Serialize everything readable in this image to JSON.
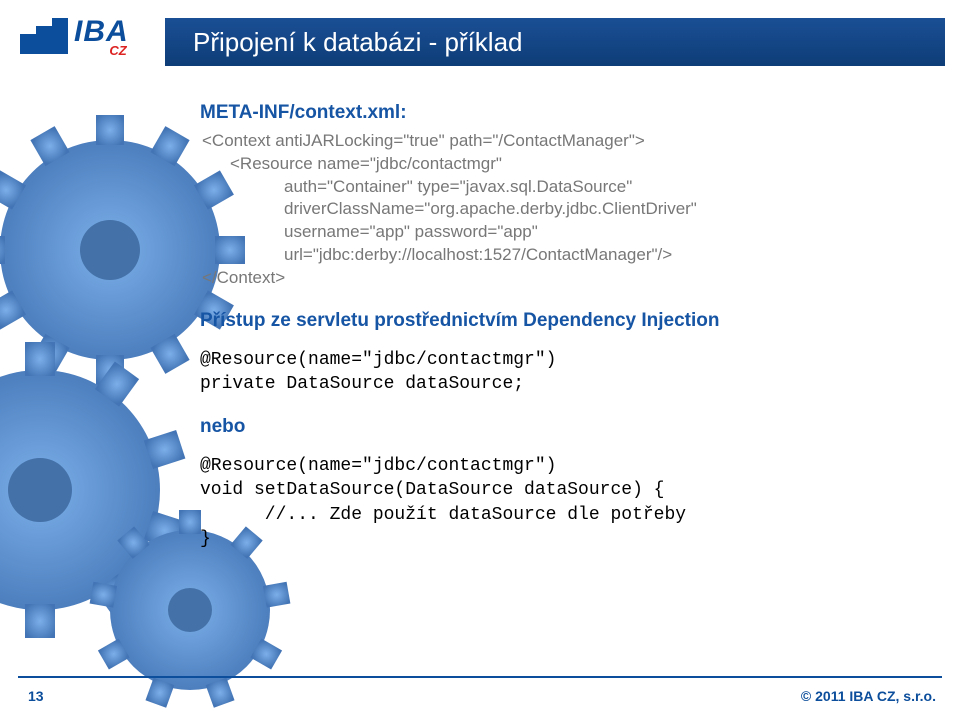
{
  "logo": {
    "iba": "IBA",
    "cz": "CZ"
  },
  "title": "Připojení k databázi - příklad",
  "section1": {
    "head": "META-INF/context.xml:",
    "l1": "<Context antiJARLocking=\"true\" path=\"/ContactManager\">",
    "l2": "<Resource name=\"jdbc/contactmgr\"",
    "l3": "auth=\"Container\" type=\"javax.sql.DataSource\"",
    "l4": "driverClassName=\"org.apache.derby.jdbc.ClientDriver\"",
    "l5": "username=\"app\" password=\"app\"",
    "l6": "url=\"jdbc:derby://localhost:1527/ContactManager\"/>",
    "l7": "</Context>"
  },
  "di_head": "Přístup ze servletu prostřednictvím Dependency Injection",
  "code1": {
    "l1": "@Resource(name=\"jdbc/contactmgr\")",
    "l2": "private DataSource dataSource;"
  },
  "nebo": "nebo",
  "code2": {
    "l1": "@Resource(name=\"jdbc/contactmgr\")",
    "l2": "void setDataSource(DataSource dataSource) {",
    "l3": "      //... Zde použít dataSource dle potřeby",
    "l4": "}"
  },
  "footer": {
    "page": "13",
    "copyright": "© 2011 IBA CZ, s.r.o."
  }
}
